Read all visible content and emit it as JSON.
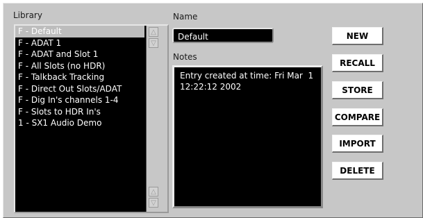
{
  "library": {
    "label": "Library",
    "items": [
      {
        "label": "F - Default",
        "selected": true
      },
      {
        "label": "F - ADAT 1",
        "selected": false
      },
      {
        "label": "F - ADAT and Slot 1",
        "selected": false
      },
      {
        "label": "F - All Slots (no HDR)",
        "selected": false
      },
      {
        "label": "F - Talkback Tracking",
        "selected": false
      },
      {
        "label": "F - Direct Out Slots/ADAT",
        "selected": false
      },
      {
        "label": "F - Dig In's channels 1-4",
        "selected": false
      },
      {
        "label": "F - Slots to HDR In's",
        "selected": false
      },
      {
        "label": "1 - SX1 Audio Demo",
        "selected": false
      }
    ],
    "scroll_up_icon": "up-triangle-icon",
    "scroll_down_icon": "down-triangle-icon"
  },
  "name": {
    "label": "Name",
    "value": "Default"
  },
  "notes": {
    "label": "Notes",
    "value": "Entry created at time: Fri Mar  1\n12:22:12 2002"
  },
  "buttons": {
    "new": "NEW",
    "recall": "RECALL",
    "store": "STORE",
    "compare": "COMPARE",
    "import": "IMPORT",
    "delete": "DELETE"
  },
  "colors": {
    "panel": "#c7c7c7",
    "list_bg": "#000000",
    "selected": "#bdbdbd"
  }
}
